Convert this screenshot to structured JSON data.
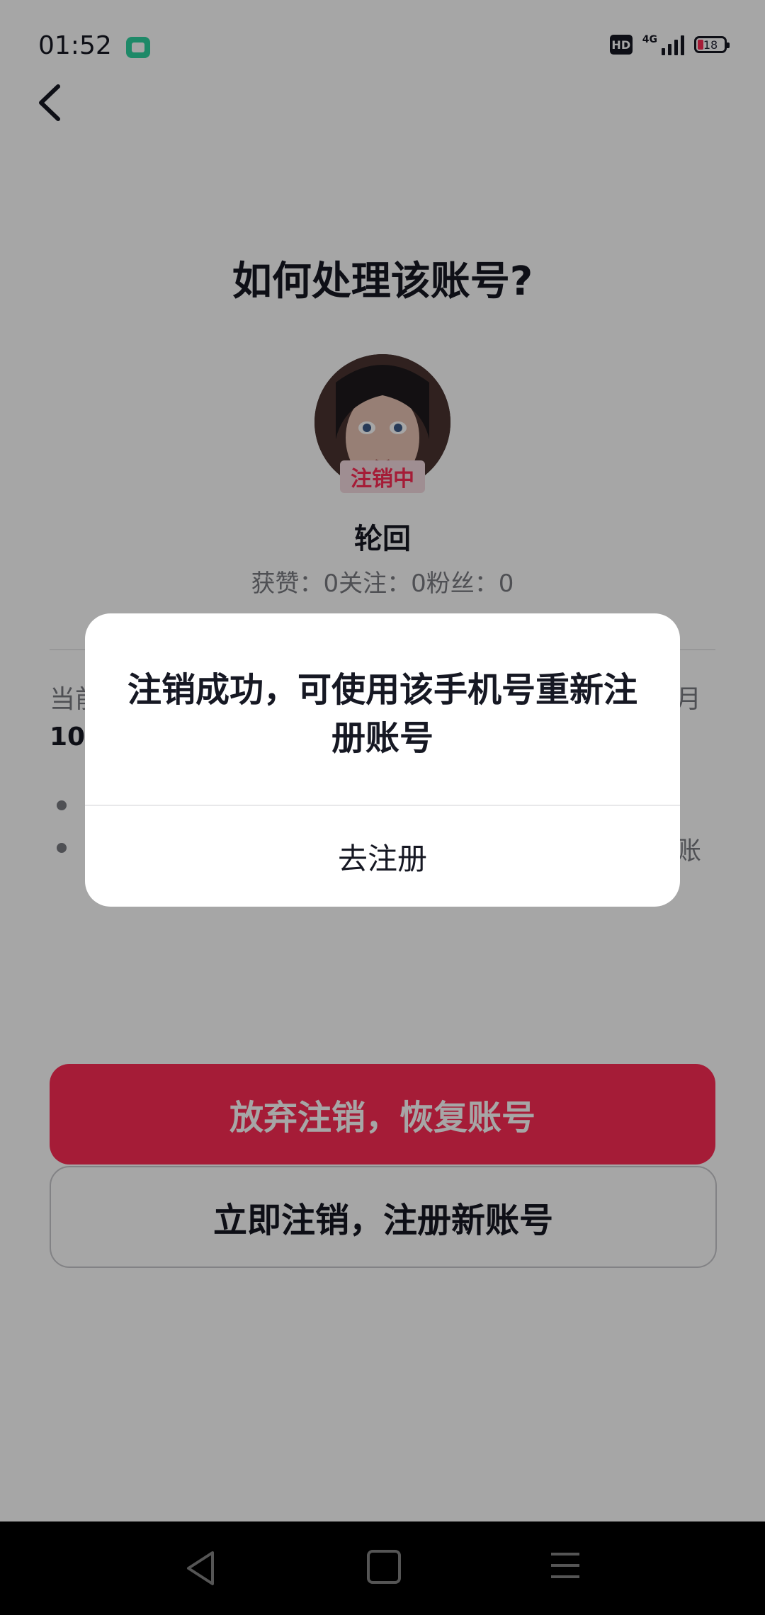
{
  "status_bar": {
    "time": "01:52",
    "hd": "HD",
    "network": "4G",
    "battery": "18"
  },
  "page": {
    "title": "如何处理该账号?",
    "avatar_badge": "注销中",
    "username": "轮回",
    "stats": "获赞：0关注：0粉丝：0",
    "info_prefix": "当前",
    "info_line2_prefix": "10",
    "info_suffix": "月",
    "list_tail_1": "，",
    "list_tail_2": "账"
  },
  "buttons": {
    "restore": "放弃注销，恢复账号",
    "register_new": "立即注销，注册新账号"
  },
  "dialog": {
    "message": "注销成功，可使用该手机号重新注册账号",
    "action": "去注册"
  },
  "colors": {
    "accent": "#fe2c55",
    "text": "#161823",
    "muted": "#7a7b82"
  },
  "icons": {
    "back": "chevron-left-icon",
    "nav_back": "triangle-back-icon",
    "nav_home": "square-home-icon",
    "nav_menu": "menu-icon"
  }
}
